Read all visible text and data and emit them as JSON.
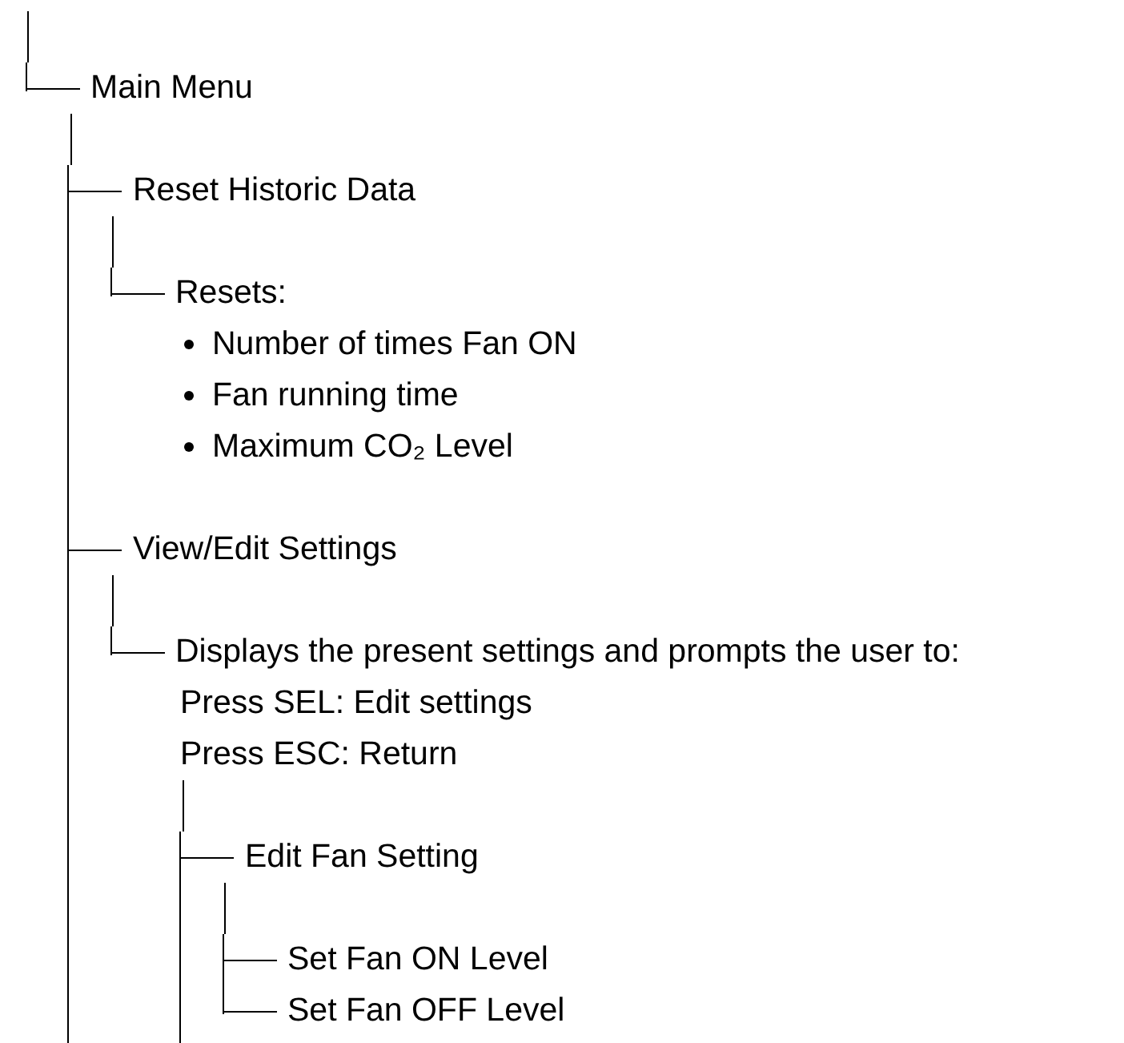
{
  "tree": [
    {
      "label": "Main Menu",
      "last": true,
      "children": [
        {
          "label": "Reset Historic Data",
          "last": false,
          "children": [
            {
              "label": "Resets:",
              "last": true,
              "bullets": [
                "Number of times Fan ON",
                "Fan running time",
                "Maximum CO₂ Level"
              ]
            }
          ]
        },
        {
          "label": "View/Edit Settings",
          "last": false,
          "children": [
            {
              "label": "Displays the present settings and prompts the user to:",
              "last": true,
              "lines": [
                "Press SEL: Edit settings",
                "Press ESC: Return"
              ],
              "children": [
                {
                  "label": "Edit Fan Setting",
                  "last": false,
                  "children": [
                    {
                      "label": "Set Fan ON Level",
                      "last": false
                    },
                    {
                      "label": "Set Fan OFF Level",
                      "last": true
                    }
                  ]
                }
              ]
            }
          ]
        }
      ]
    }
  ]
}
